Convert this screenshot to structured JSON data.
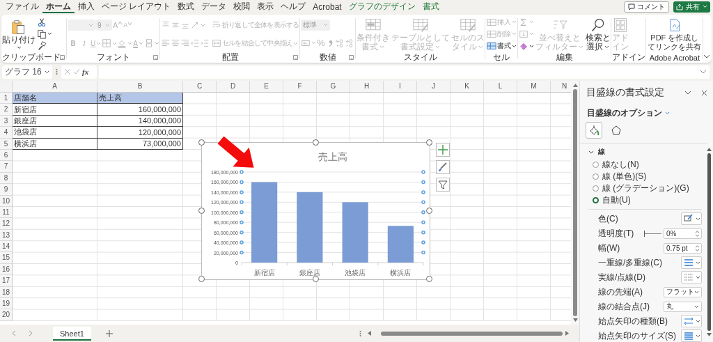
{
  "menu_tabs": [
    {
      "label": "ファイル",
      "selected": false,
      "kind": "normal"
    },
    {
      "label": "ホーム",
      "selected": true,
      "kind": "normal"
    },
    {
      "label": "挿入",
      "selected": false,
      "kind": "normal"
    },
    {
      "label": "ページ レイアウト",
      "selected": false,
      "kind": "normal"
    },
    {
      "label": "数式",
      "selected": false,
      "kind": "normal"
    },
    {
      "label": "データ",
      "selected": false,
      "kind": "normal"
    },
    {
      "label": "校閲",
      "selected": false,
      "kind": "normal"
    },
    {
      "label": "表示",
      "selected": false,
      "kind": "normal"
    },
    {
      "label": "ヘルプ",
      "selected": false,
      "kind": "normal"
    },
    {
      "label": "Acrobat",
      "selected": false,
      "kind": "normal"
    },
    {
      "label": "グラフのデザイン",
      "selected": false,
      "kind": "contextual"
    },
    {
      "label": "書式",
      "selected": false,
      "kind": "contextual"
    }
  ],
  "comment_button": {
    "label": "コメント"
  },
  "share_button": {
    "label": "共有"
  },
  "ribbon": {
    "groups": [
      {
        "label": "クリップボード",
        "launcher": true,
        "columns": [
          [
            [
              {
                "kind": "paste",
                "label": "貼り付け",
                "disabled": false
              }
            ]
          ],
          [
            [
              {
                "kind": "cut",
                "disabled": false
              }
            ],
            [
              {
                "kind": "copy",
                "disabled": false
              }
            ],
            [
              {
                "kind": "brush",
                "disabled": false
              }
            ]
          ]
        ]
      },
      {
        "label": "フォント",
        "launcher": true,
        "columns": [
          [
            [
              {
                "kind": "font-combo",
                "disabled": true
              },
              {
                "kind": "size-combo",
                "value": "9",
                "disabled": true
              },
              {
                "kind": "grow",
                "label": "A",
                "disabled": true
              },
              {
                "kind": "shrink",
                "label": "A",
                "disabled": true
              }
            ],
            [
              {
                "kind": "bold",
                "label": "B",
                "disabled": true
              },
              {
                "kind": "italic",
                "label": "I",
                "disabled": true
              },
              {
                "kind": "underline",
                "label": "U",
                "disabled": true
              },
              {
                "kind": "borders",
                "disabled": true
              },
              {
                "kind": "fill-color",
                "disabled": true
              },
              {
                "kind": "font-color",
                "label": "A",
                "disabled": true
              },
              {
                "kind": "phonetic",
                "disabled": true
              }
            ]
          ]
        ]
      },
      {
        "label": "配置",
        "launcher": true,
        "columns": [
          [
            [
              {
                "kind": "align-top",
                "disabled": true
              },
              {
                "kind": "align-middle",
                "disabled": true
              },
              {
                "kind": "align-bottom",
                "disabled": true
              },
              {
                "kind": "orientation",
                "disabled": true
              }
            ],
            [
              {
                "kind": "align-left",
                "disabled": true
              },
              {
                "kind": "align-center",
                "disabled": true
              },
              {
                "kind": "align-right",
                "disabled": true
              },
              {
                "kind": "outdent",
                "disabled": true
              },
              {
                "kind": "indent",
                "disabled": true
              }
            ]
          ],
          [
            [
              {
                "kind": "wrap",
                "label": "折り返して全体を表示する",
                "disabled": true
              }
            ],
            [
              {
                "kind": "merge",
                "label": "セルを結合して中央揃え",
                "disabled": true
              }
            ]
          ]
        ]
      },
      {
        "label": "数値",
        "launcher": true,
        "columns": [
          [
            [
              {
                "kind": "number-combo",
                "value": "標準",
                "disabled": true
              }
            ],
            [
              {
                "kind": "accounting",
                "disabled": true
              },
              {
                "kind": "percent",
                "label": "%",
                "disabled": true
              },
              {
                "kind": "comma",
                "disabled": true
              },
              {
                "kind": "inc-decimal",
                "disabled": true
              },
              {
                "kind": "dec-decimal",
                "disabled": true
              }
            ]
          ]
        ]
      },
      {
        "label": "スタイル",
        "launcher": false,
        "columns": [
          [
            [
              {
                "kind": "cond-format",
                "label": "条件付き書式",
                "disabled": true
              }
            ]
          ],
          [
            [
              {
                "kind": "table-format",
                "label": "テーブルとして書式設定",
                "disabled": true
              }
            ]
          ],
          [
            [
              {
                "kind": "cell-style",
                "label": "セルのスタイル",
                "disabled": true
              }
            ]
          ]
        ]
      },
      {
        "label": "セル",
        "launcher": false,
        "columns": [
          [
            [
              {
                "kind": "insert",
                "label": "挿入",
                "disabled": true
              }
            ],
            [
              {
                "kind": "delete",
                "label": "削除",
                "disabled": true
              }
            ],
            [
              {
                "kind": "format-cells",
                "label": "書式",
                "disabled": false
              }
            ]
          ]
        ]
      },
      {
        "label": "編集",
        "launcher": false,
        "columns": [
          [
            [
              {
                "kind": "sum",
                "disabled": true
              }
            ],
            [
              {
                "kind": "fill-down",
                "disabled": true
              }
            ],
            [
              {
                "kind": "clear",
                "disabled": false
              }
            ]
          ],
          [
            [
              {
                "kind": "sort",
                "label": "並べ替えとフィルター",
                "disabled": true
              }
            ]
          ],
          [
            [
              {
                "kind": "find",
                "label": "検索と選択",
                "disabled": false
              }
            ]
          ]
        ]
      },
      {
        "label": "アドイン",
        "launcher": false,
        "columns": [
          [
            [
              {
                "kind": "addins",
                "label": "アドイン",
                "disabled": true
              }
            ]
          ]
        ]
      },
      {
        "label": "Adobe Acrobat",
        "launcher": false,
        "columns": [
          [
            [
              {
                "kind": "pdf",
                "label": "PDF を作成してリンクを共有",
                "disabled": false
              }
            ]
          ]
        ]
      }
    ]
  },
  "formula_bar": {
    "name_box": "グラフ 16",
    "function_label": "fx"
  },
  "sheet": {
    "columns": [
      "A",
      "B",
      "C",
      "D",
      "E",
      "F",
      "G",
      "H",
      "I",
      "J",
      "K",
      "L",
      "M",
      "N"
    ],
    "row_numbers": [
      "1",
      "2",
      "3",
      "4",
      "5",
      "6",
      "7",
      "8",
      "9",
      "10",
      "11",
      "12",
      "13",
      "14",
      "15",
      "16",
      "17",
      "18",
      "19",
      "20"
    ],
    "header": [
      "店舗名",
      "売上高"
    ],
    "rows": [
      [
        "新宿店",
        "160,000,000"
      ],
      [
        "銀座店",
        "140,000,000"
      ],
      [
        "池袋店",
        "120,000,000"
      ],
      [
        "横浜店",
        "73,000,000"
      ]
    ]
  },
  "chart": {
    "selected": true,
    "chart_data": {
      "type": "bar",
      "grid": true,
      "title": "売上高",
      "categories": [
        "新宿店",
        "銀座店",
        "池袋店",
        "横浜店"
      ],
      "series": [
        {
          "color": "#7b9cd4",
          "values": [
            160000000,
            140000000,
            120000000,
            73000000
          ]
        }
      ],
      "ylim": [
        0,
        180000000
      ],
      "yticks": [
        {
          "value": 0,
          "label": "0"
        },
        {
          "value": 20000000,
          "label": "20,000,000"
        },
        {
          "value": 40000000,
          "label": "40,000,000"
        },
        {
          "value": 60000000,
          "label": "60,000,000"
        },
        {
          "value": 80000000,
          "label": "80,000,000"
        },
        {
          "value": 100000000,
          "label": "100,000,000"
        },
        {
          "value": 120000000,
          "label": "120,000,000"
        },
        {
          "value": 140000000,
          "label": "140,000,000"
        },
        {
          "value": 160000000,
          "label": "160,000,000"
        },
        {
          "value": 180000000,
          "label": "180,000,000"
        }
      ]
    }
  },
  "sheet_tabs": [
    {
      "label": "Sheet1",
      "selected": true
    }
  ],
  "format_pane": {
    "title": "目盛線の書式設定",
    "options_label": "目盛線のオプション",
    "icon_tabs": [
      {
        "kind": "fill-line",
        "selected": true
      },
      {
        "kind": "effects",
        "selected": false
      }
    ],
    "section": {
      "label": "線",
      "expanded": true
    },
    "line_options": [
      {
        "label": "線なし(N)",
        "selected": false
      },
      {
        "label": "線 (単色)(S)",
        "selected": false
      },
      {
        "label": "線 (グラデーション)(G)",
        "selected": false
      },
      {
        "label": "自動(U)",
        "selected": true
      }
    ],
    "properties": [
      {
        "kind": "color",
        "label": "色(C)"
      },
      {
        "kind": "slider",
        "label": "透明度(T)",
        "level": 0,
        "value": "0%"
      },
      {
        "kind": "spin",
        "label": "幅(W)",
        "value": "0.75 pt"
      },
      {
        "kind": "compound",
        "label": "一重線/多重線(C)"
      },
      {
        "kind": "dash",
        "label": "実線/点線(D)"
      },
      {
        "kind": "dropdown",
        "label": "線の先端(A)",
        "value": "フラット"
      },
      {
        "kind": "dropdown",
        "label": "線の結合点(J)",
        "value": "丸"
      },
      {
        "kind": "arrow-type",
        "label": "始点矢印の種類(B)"
      },
      {
        "kind": "arrow-size",
        "label": "始点矢印のサイズ(S)"
      }
    ]
  }
}
